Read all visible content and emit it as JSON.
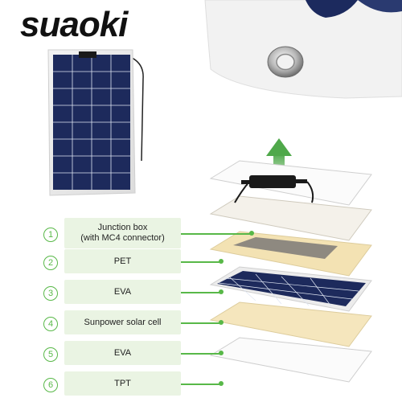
{
  "brand": {
    "name": "suaoki"
  },
  "layers": [
    {
      "number": "1",
      "label": "Junction box\n(with MC4 connector)"
    },
    {
      "number": "2",
      "label": "PET"
    },
    {
      "number": "3",
      "label": "EVA"
    },
    {
      "number": "4",
      "label": "Sunpower solar cell"
    },
    {
      "number": "5",
      "label": "EVA"
    },
    {
      "number": "6",
      "label": "TPT"
    }
  ],
  "colors": {
    "accent_green": "#58b848",
    "label_bg": "#eaf4e3",
    "cell_blue": "#1d2a5c",
    "eva_tan": "#f3e2b3"
  },
  "icons": [
    "grommet-icon",
    "up-arrow-icon"
  ]
}
